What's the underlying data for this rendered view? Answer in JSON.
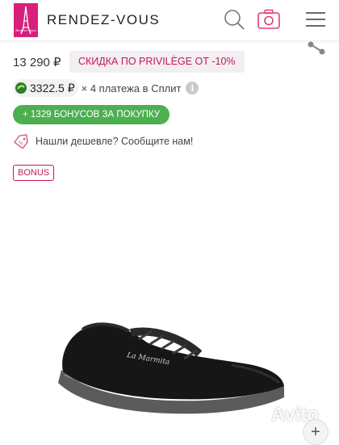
{
  "header": {
    "brand": "RENDEZ-VOUS",
    "logo_text": "Rendez-Vous",
    "icons": [
      "search-icon",
      "camera-icon",
      "menu-icon"
    ]
  },
  "price": {
    "value": "13 290 ₽",
    "discount_label": "СКИДКА ПО PRIVILÈGE ОТ -10%"
  },
  "split": {
    "amount": "3322.5 ₽",
    "text": "× 4 платежа в Сплит"
  },
  "bonus": {
    "label": "+ 1329 БОНУСОВ ЗА ПОКУПКУ"
  },
  "cheaper": {
    "text": "Нашли дешевле? Сообщите нам!"
  },
  "badge": {
    "label": "BONUS"
  },
  "product": {
    "print_text": "La Marmita",
    "watermark": "Avito"
  },
  "colors": {
    "brand_pink": "#d8207a",
    "discount_text": "#c2185b",
    "bonus_green": "#4caf50"
  }
}
